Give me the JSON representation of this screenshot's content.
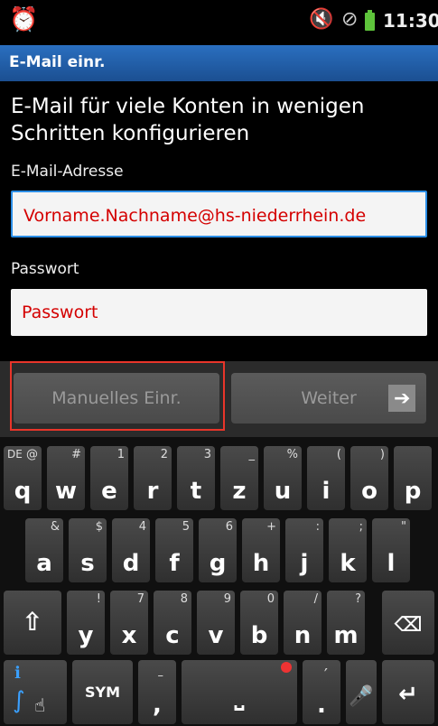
{
  "status_bar": {
    "time": "11:30"
  },
  "title_bar": {
    "title": "E-Mail einr."
  },
  "form": {
    "intro": "E-Mail für viele Konten in wenigen Schritten konfigurieren",
    "email_label": "E-Mail-Adresse",
    "email_value": "Vorname.Nachname@hs-niederrhein.de",
    "password_label": "Passwort",
    "password_value": "Passwort"
  },
  "buttons": {
    "manual": "Manuelles Einr.",
    "next": "Weiter"
  },
  "keyboard": {
    "lang": "DE",
    "row1": [
      {
        "k": "q",
        "a": "@"
      },
      {
        "k": "w",
        "a": "#"
      },
      {
        "k": "e",
        "a": "1"
      },
      {
        "k": "r",
        "a": "2"
      },
      {
        "k": "t",
        "a": "3"
      },
      {
        "k": "z",
        "a": "_"
      },
      {
        "k": "u",
        "a": "%"
      },
      {
        "k": "i",
        "a": "("
      },
      {
        "k": "o",
        "a": ")"
      },
      {
        "k": "p",
        "a": ""
      }
    ],
    "row2": [
      {
        "k": "a",
        "a": "&"
      },
      {
        "k": "s",
        "a": "$"
      },
      {
        "k": "d",
        "a": "4"
      },
      {
        "k": "f",
        "a": "5"
      },
      {
        "k": "g",
        "a": "6"
      },
      {
        "k": "h",
        "a": "+"
      },
      {
        "k": "j",
        "a": ":"
      },
      {
        "k": "k",
        "a": ";"
      },
      {
        "k": "l",
        "a": "\""
      }
    ],
    "row3": [
      {
        "k": "y",
        "a": "!"
      },
      {
        "k": "x",
        "a": "7"
      },
      {
        "k": "c",
        "a": "8"
      },
      {
        "k": "v",
        "a": "9"
      },
      {
        "k": "b",
        "a": "0"
      },
      {
        "k": "n",
        "a": "/"
      },
      {
        "k": "m",
        "a": "?"
      }
    ],
    "sym_label": "SYM",
    "comma": ",",
    "period": "."
  }
}
